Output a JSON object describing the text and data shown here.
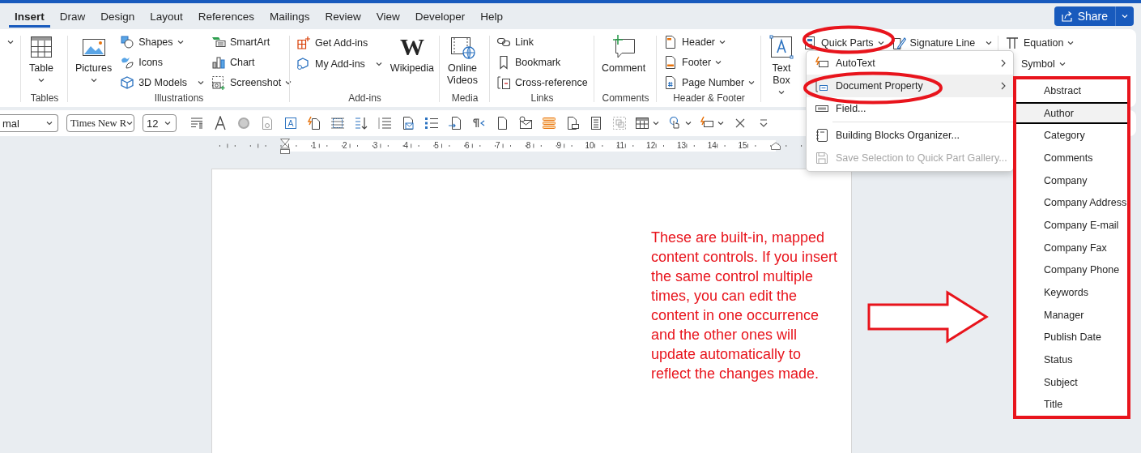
{
  "tabs": [
    {
      "label": "Insert",
      "selected": true
    },
    {
      "label": "Draw",
      "selected": false
    },
    {
      "label": "Design",
      "selected": false
    },
    {
      "label": "Layout",
      "selected": false
    },
    {
      "label": "References",
      "selected": false
    },
    {
      "label": "Mailings",
      "selected": false
    },
    {
      "label": "Review",
      "selected": false
    },
    {
      "label": "View",
      "selected": false
    },
    {
      "label": "Developer",
      "selected": false
    },
    {
      "label": "Help",
      "selected": false
    }
  ],
  "share": {
    "label": "Share"
  },
  "ribbon": {
    "groups": [
      {
        "label": "Tables",
        "columns": [
          [
            {
              "label": "Table",
              "kind": "large",
              "dropdown": true
            }
          ]
        ]
      },
      {
        "label": "Illustrations",
        "columns": [
          [
            {
              "label": "Pictures",
              "kind": "large",
              "dropdown": true
            }
          ],
          [
            {
              "label": "Shapes",
              "kind": "small",
              "dropdown": true
            },
            {
              "label": "Icons",
              "kind": "small",
              "dropdown": false
            },
            {
              "label": "3D Models",
              "kind": "small",
              "dropdown": true
            }
          ],
          [
            {
              "label": "SmartArt",
              "kind": "small",
              "dropdown": false
            },
            {
              "label": "Chart",
              "kind": "small",
              "dropdown": false
            },
            {
              "label": "Screenshot",
              "kind": "small",
              "dropdown": true
            }
          ]
        ]
      },
      {
        "label": "Add-ins",
        "columns": [
          [
            {
              "label": "Get Add-ins",
              "kind": "small",
              "dropdown": false
            },
            {
              "label": "My Add-ins",
              "kind": "small",
              "dropdown": true
            }
          ],
          [
            {
              "label": "Wikipedia",
              "kind": "large",
              "dropdown": false,
              "glyph": "W"
            }
          ]
        ]
      },
      {
        "label": "Media",
        "columns": [
          [
            {
              "label": "Online Videos",
              "kind": "large",
              "dropdown": false
            }
          ]
        ]
      },
      {
        "label": "Links",
        "columns": [
          [
            {
              "label": "Link",
              "kind": "small",
              "dropdown": false
            },
            {
              "label": "Bookmark",
              "kind": "small",
              "dropdown": false
            },
            {
              "label": "Cross-reference",
              "kind": "small",
              "dropdown": false
            }
          ]
        ]
      },
      {
        "label": "Comments",
        "columns": [
          [
            {
              "label": "Comment",
              "kind": "large",
              "dropdown": false
            }
          ]
        ]
      },
      {
        "label": "Header & Footer",
        "columns": [
          [
            {
              "label": "Header",
              "kind": "small",
              "dropdown": true
            },
            {
              "label": "Footer",
              "kind": "small",
              "dropdown": true
            },
            {
              "label": "Page Number",
              "kind": "small",
              "dropdown": true
            }
          ]
        ]
      },
      {
        "columns": [
          [
            {
              "label": "Text Box",
              "kind": "large",
              "dropdown": true
            }
          ],
          [
            {
              "label": "Quick Parts",
              "kind": "small",
              "dropdown": true
            }
          ],
          [
            {
              "label": "Signature Line",
              "kind": "small",
              "dropdown": true
            }
          ]
        ]
      },
      {
        "columns": [
          [
            {
              "label": "Equation",
              "kind": "small",
              "dropdown": true
            },
            {
              "label": "Symbol",
              "kind": "small",
              "dropdown": true
            }
          ]
        ]
      }
    ]
  },
  "quick_access": {
    "style": "mal",
    "font": "Times New R",
    "size": "12"
  },
  "ruler": {
    "numbers": [
      "1",
      "2",
      "3",
      "4",
      "5",
      "6",
      "7",
      "8",
      "9",
      "10",
      "11",
      "12",
      "13",
      "14",
      "15"
    ]
  },
  "annotation": {
    "text": "These are built-in, mapped\ncontent controls. If you insert\nthe same control multiple\ntimes, you can edit the\ncontent in one occurrence\nand the other ones will\nupdate automatically to\nreflect the changes made."
  },
  "quick_parts_menu": {
    "items": [
      {
        "kind": "item",
        "label": "AutoText",
        "submenu": true,
        "selected": false,
        "disabled": false
      },
      {
        "kind": "item",
        "label": "Document Property",
        "submenu": true,
        "selected": true,
        "disabled": false
      },
      {
        "kind": "item",
        "label": "Field...",
        "submenu": false,
        "selected": false,
        "disabled": false
      },
      {
        "kind": "separator"
      },
      {
        "kind": "item",
        "label": "Building Blocks Organizer...",
        "submenu": false,
        "selected": false,
        "disabled": false
      },
      {
        "kind": "item",
        "label": "Save Selection to Quick Part Gallery...",
        "submenu": false,
        "selected": false,
        "disabled": true
      }
    ]
  },
  "document_property_menu": {
    "items": [
      {
        "label": "Abstract",
        "selected": false
      },
      {
        "label": "Author",
        "selected": true
      },
      {
        "label": "Category",
        "selected": false
      },
      {
        "label": "Comments",
        "selected": false
      },
      {
        "label": "Company",
        "selected": false
      },
      {
        "label": "Company Address",
        "selected": false
      },
      {
        "label": "Company E-mail",
        "selected": false
      },
      {
        "label": "Company Fax",
        "selected": false
      },
      {
        "label": "Company Phone",
        "selected": false
      },
      {
        "label": "Keywords",
        "selected": false
      },
      {
        "label": "Manager",
        "selected": false
      },
      {
        "label": "Publish Date",
        "selected": false
      },
      {
        "label": "Status",
        "selected": false
      },
      {
        "label": "Subject",
        "selected": false
      },
      {
        "label": "Title",
        "selected": false
      }
    ]
  }
}
